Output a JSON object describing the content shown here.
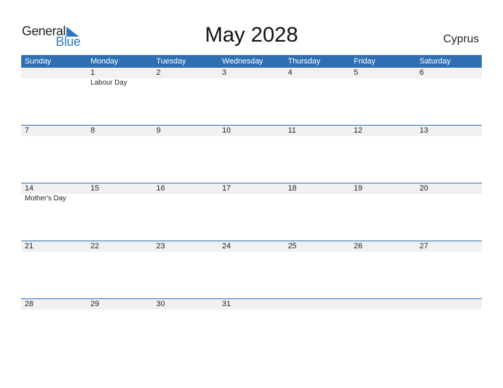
{
  "logo": {
    "part1": "General",
    "part2": "Blue"
  },
  "title": "May 2028",
  "country": "Cyprus",
  "colors": {
    "accent": "#2e6fb3",
    "row_bg": "#f1f1f1"
  },
  "days": [
    "Sunday",
    "Monday",
    "Tuesday",
    "Wednesday",
    "Thursday",
    "Friday",
    "Saturday"
  ],
  "weeks": [
    {
      "dates": [
        "",
        "1",
        "2",
        "3",
        "4",
        "5",
        "6"
      ],
      "events": [
        "",
        "Labour Day",
        "",
        "",
        "",
        "",
        ""
      ]
    },
    {
      "dates": [
        "7",
        "8",
        "9",
        "10",
        "11",
        "12",
        "13"
      ],
      "events": [
        "",
        "",
        "",
        "",
        "",
        "",
        ""
      ]
    },
    {
      "dates": [
        "14",
        "15",
        "16",
        "17",
        "18",
        "19",
        "20"
      ],
      "events": [
        "Mother's Day",
        "",
        "",
        "",
        "",
        "",
        ""
      ]
    },
    {
      "dates": [
        "21",
        "22",
        "23",
        "24",
        "25",
        "26",
        "27"
      ],
      "events": [
        "",
        "",
        "",
        "",
        "",
        "",
        ""
      ]
    },
    {
      "dates": [
        "28",
        "29",
        "30",
        "31",
        "",
        "",
        ""
      ],
      "events": [
        "",
        "",
        "",
        "",
        "",
        "",
        ""
      ]
    }
  ]
}
